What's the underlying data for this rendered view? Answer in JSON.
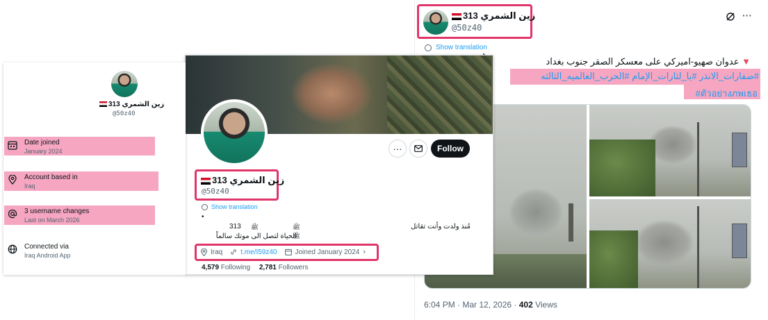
{
  "profile": {
    "display_name": "زين الشمري 313",
    "handle": "@50z40",
    "show_translation": "Show translation"
  },
  "tweet": {
    "text_line1": "عدوان صهيو-اميركي على معسكر الصقر جنوب بغداد",
    "hashtags_line1": "#صفارات_الانذر #يا_لثارات_الإمام #الحرب_العالميه_الثالثه",
    "hashtags_line2": "#ตัวอย่างภพเธอ",
    "time": "6:04 PM · Mar 12, 2026 · ",
    "views_count": "402",
    "views_label": " Views",
    "more": "···"
  },
  "card": {
    "follow_label": "Follow",
    "more": "···",
    "bio_dot": "•",
    "bio_num": "313",
    "bio_mark1": "ﷺ",
    "bio_mark2": "ﷺ",
    "bio_mark3": "ﷺ",
    "bio_right": "مُنذ ولدت وأنت تقاتل",
    "bio_line2": "الحياة لتصل الى موتك سالماً",
    "location": "Iraq",
    "website": "t.me/I59z40",
    "joined": "Joined January 2024",
    "following_count": "4,579",
    "following_label": " Following",
    "followers_count": "2,781",
    "followers_label": " Followers"
  },
  "about": {
    "name": "زين الشمري 313",
    "handle": "@50z40",
    "items": [
      {
        "title": "Date joined",
        "sub": "January 2024",
        "icon": "calendar-icon"
      },
      {
        "title": "Account based in",
        "sub": "Iraq",
        "icon": "location-pin-icon"
      },
      {
        "title": "3 username changes",
        "sub": "Last on March 2026",
        "icon": "at-icon"
      },
      {
        "title": "Connected via",
        "sub": "Iraq Android App",
        "icon": "globe-icon"
      }
    ]
  },
  "colors": {
    "highlight_border": "#e0356a",
    "highlight_fill": "#f6a6c1",
    "link": "#1d9bf0"
  }
}
